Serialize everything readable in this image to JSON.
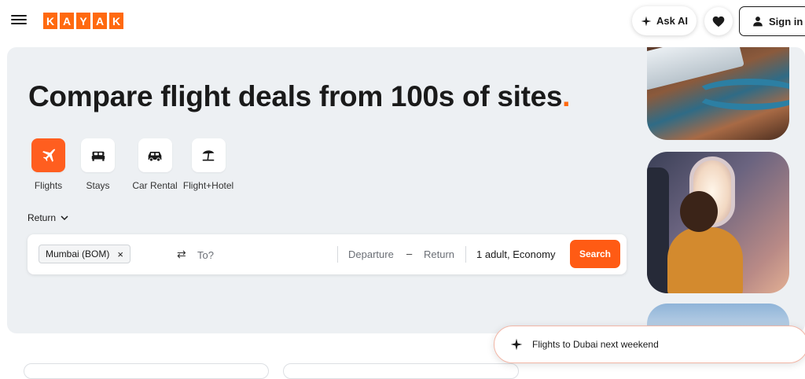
{
  "header": {
    "logo_letters": [
      "K",
      "A",
      "Y",
      "A",
      "K"
    ],
    "ask_ai_label": "Ask AI",
    "sign_in_label": "Sign in"
  },
  "hero": {
    "headline": "Compare flight deals from 100s of sites",
    "headline_dot": ".",
    "verticals": [
      {
        "label": "Flights",
        "icon": "airplane-icon",
        "active": true
      },
      {
        "label": "Stays",
        "icon": "bed-icon",
        "active": false
      },
      {
        "label": "Car Rental",
        "icon": "car-icon",
        "active": false
      },
      {
        "label": "Flight+Hotel",
        "icon": "beach-umbrella-icon",
        "active": false
      }
    ],
    "trip_type": "Return"
  },
  "search": {
    "origin": "Mumbai (BOM)",
    "origin_remove": "×",
    "swap_glyph": "⇄",
    "destination_placeholder": "To?",
    "departure_label": "Departure",
    "date_separator": "–",
    "return_label": "Return",
    "travellers": "1 adult, Economy",
    "search_button": "Search"
  },
  "ai_prompt": {
    "text": "Flights to Dubai next weekend"
  },
  "colors": {
    "brand_orange": "#ff690f",
    "search_button": "#ff5b14",
    "hero_bg": "#edf0f3"
  }
}
